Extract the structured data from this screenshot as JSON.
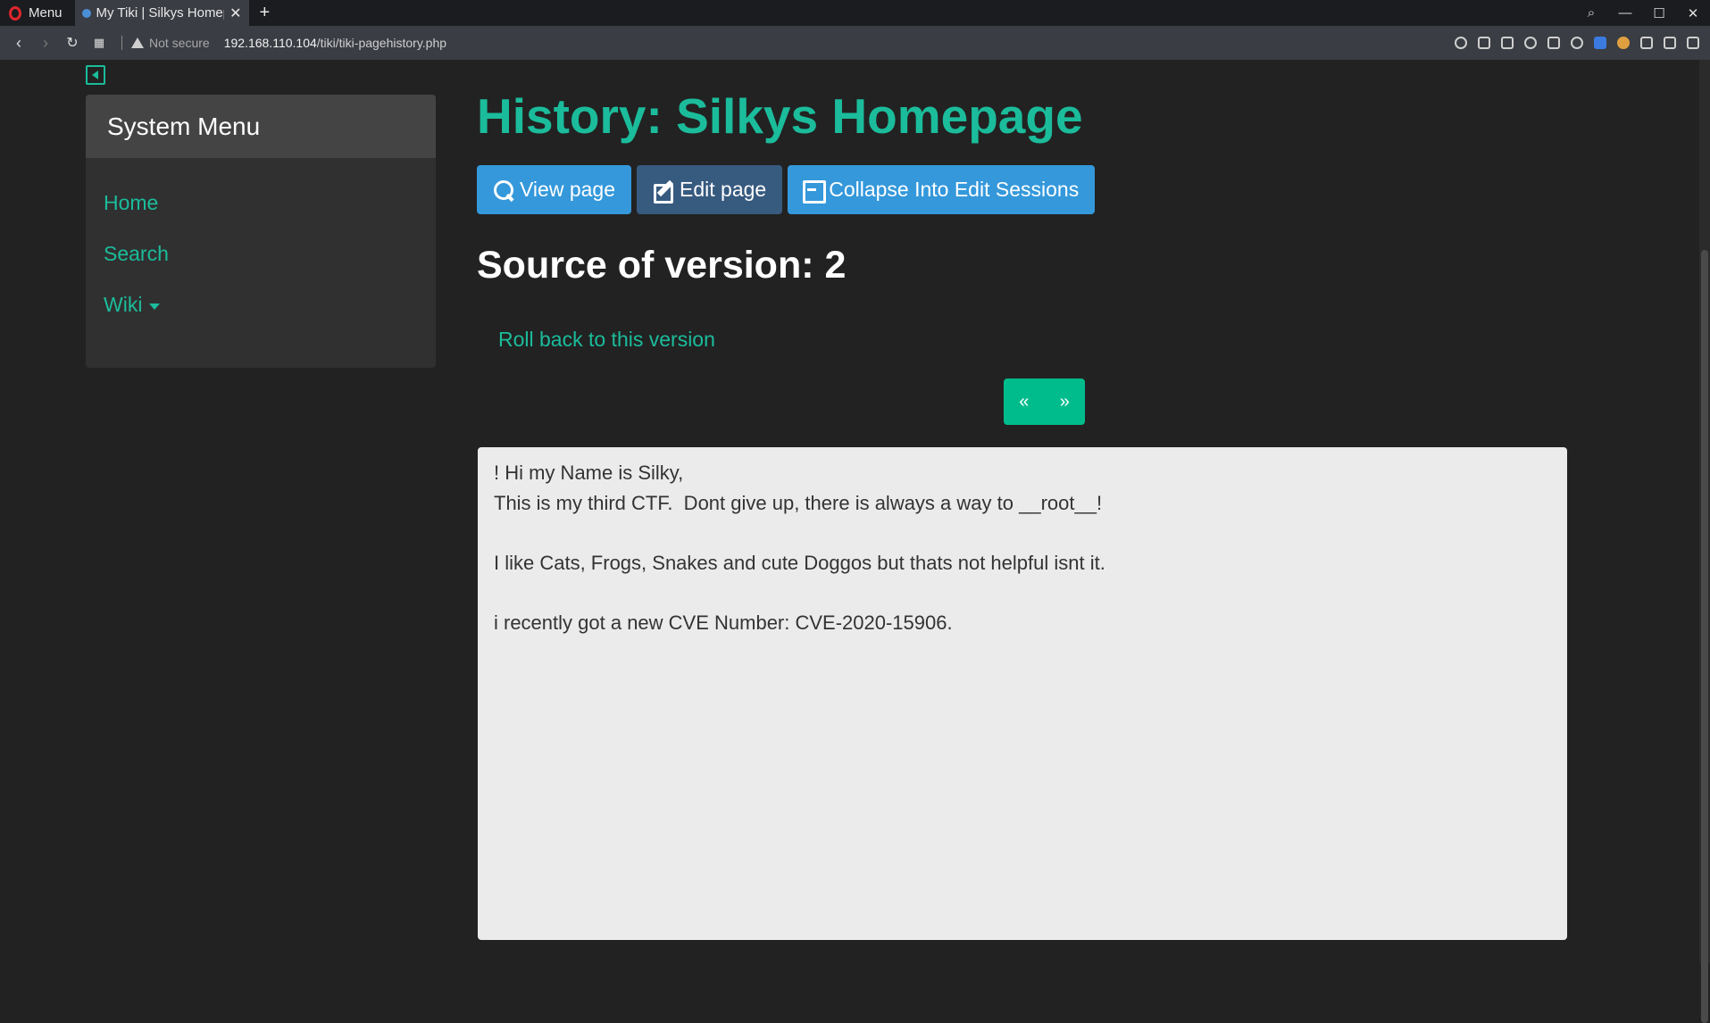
{
  "browser": {
    "menu_label": "Menu",
    "tab_title": "My Tiki | Silkys Homepage",
    "security_label": "Not secure",
    "url_host": "192.168.110.104",
    "url_path": "/tiki/tiki-pagehistory.php"
  },
  "sidebar": {
    "title": "System Menu",
    "items": [
      {
        "label": "Home"
      },
      {
        "label": "Search"
      },
      {
        "label": "Wiki"
      }
    ]
  },
  "page": {
    "title": "History: Silkys Homepage",
    "buttons": {
      "view": "View page",
      "edit": "Edit page",
      "collapse": "Collapse Into Edit Sessions"
    },
    "subtitle": "Source of version: 2",
    "rollback": "Roll back to this version",
    "pager": {
      "prev": "«",
      "next": "»"
    },
    "source_text": "! Hi my Name is Silky,\nThis is my third CTF.  Dont give up, there is always a way to __root__!\n\nI like Cats, Frogs, Snakes and cute Doggos but thats not helpful isnt it.\n\ni recently got a new CVE Number: CVE-2020-15906."
  },
  "colors": {
    "accent": "#1bbc9b",
    "background": "#222222",
    "button_blue": "#3498db",
    "button_dark": "#375a7f",
    "pager_green": "#00bc8c"
  }
}
